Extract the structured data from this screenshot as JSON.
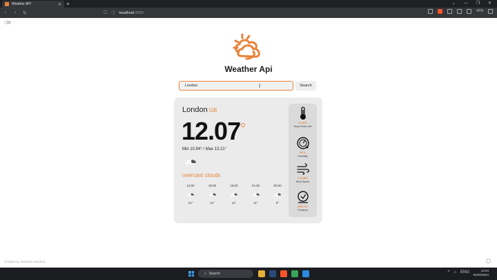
{
  "browser": {
    "tab_title": "Weather API",
    "url_host": "localhost",
    "url_port": ":3000",
    "vpn_label": "VPN",
    "brave_badge": "9"
  },
  "app": {
    "title": "Weather Api"
  },
  "search": {
    "value": "London",
    "button_label": "Search"
  },
  "weather": {
    "city": "London",
    "country": "GB",
    "temp": "12.07",
    "minmax": "Min 10.94° / Max 13.21°",
    "description": "overcast clouds",
    "hourly": [
      {
        "time": "12:00",
        "temp": "12°"
      },
      {
        "time": "15:00",
        "temp": "12°"
      },
      {
        "time": "18:00",
        "temp": "11°"
      },
      {
        "time": "21:00",
        "temp": "11°"
      },
      {
        "time": "00:00",
        "temp": "9°"
      }
    ]
  },
  "stats": {
    "feels_like": {
      "value": "11.65°C",
      "label": "Temp Feels Like"
    },
    "humidity": {
      "value": "89 %",
      "label": "Humidity"
    },
    "wind": {
      "value": "7.72 M/H",
      "label": "Wind Speed"
    },
    "pressure": {
      "value": "1024 P.O",
      "label": "Pressure"
    }
  },
  "footer": {
    "credit": "Created by Tanbakiu Nandera"
  },
  "taskbar": {
    "search_label": "Search",
    "time": "13:04",
    "date": "04/02/2024",
    "language": "ENG"
  },
  "colors": {
    "accent": "#e8833a",
    "card_bg": "#ebebeb",
    "stats_bg": "#dadada"
  }
}
